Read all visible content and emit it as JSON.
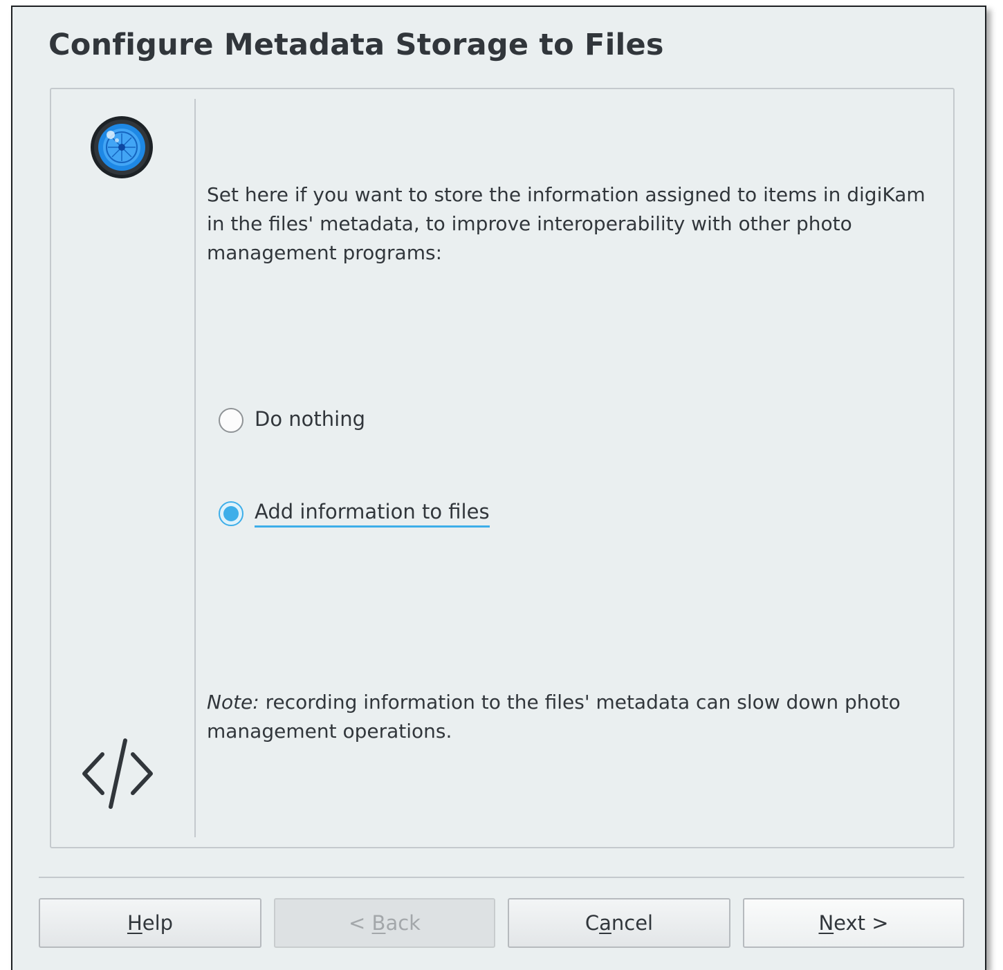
{
  "title": "Configure Metadata Storage to Files",
  "description": "Set here if you want to store the information assigned to items in digiKam in the files' metadata, to improve interoperability with other photo management programs:",
  "options": [
    {
      "label": "Do nothing",
      "checked": false
    },
    {
      "label": "Add information to files",
      "checked": true
    }
  ],
  "note": {
    "prefix": "Note:",
    "text": " recording information to the files' metadata can slow down photo management operations."
  },
  "buttons": {
    "help": {
      "mnemonic": "H",
      "rest": "elp"
    },
    "back": {
      "pre": "< ",
      "mnemonic": "B",
      "rest": "ack"
    },
    "cancel": {
      "pre": "C",
      "mnemonic": "a",
      "rest": "ncel"
    },
    "next": {
      "mnemonic": "N",
      "rest": "ext >"
    }
  },
  "icons": {
    "logo": "digikam-logo-icon",
    "code": "code-icon"
  },
  "colors": {
    "accent": "#3daee9",
    "window_bg": "#eaeff0",
    "text": "#31363b"
  }
}
